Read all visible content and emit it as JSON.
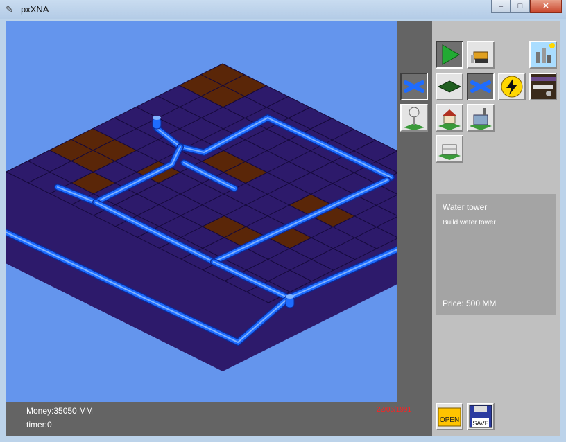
{
  "window": {
    "title": "pxXNA",
    "min": "–",
    "max": "□",
    "close": "✕"
  },
  "status": {
    "money": "Money:35050 MM",
    "timer": "timer:0",
    "date": "22/06/1991"
  },
  "info": {
    "title": "Water tower",
    "description": "Build water tower",
    "price": "Price: 500 MM"
  },
  "tools": [
    {
      "name": "play",
      "icon": "play-icon"
    },
    {
      "name": "bulldozer",
      "icon": "bulldozer-icon"
    },
    {
      "name": "city-view",
      "icon": "city-view-icon"
    },
    {
      "name": "pipe-left",
      "icon": "pipe-icon"
    },
    {
      "name": "ground",
      "icon": "ground-tile-icon"
    },
    {
      "name": "pipe",
      "icon": "pipe-icon"
    },
    {
      "name": "power",
      "icon": "lightning-icon"
    },
    {
      "name": "underground",
      "icon": "underground-icon"
    },
    {
      "name": "water-tower",
      "icon": "water-tower-icon"
    },
    {
      "name": "house",
      "icon": "house-icon"
    },
    {
      "name": "factory",
      "icon": "factory-icon"
    },
    {
      "name": "office",
      "icon": "office-icon"
    },
    {
      "name": "open",
      "icon": "folder-open-icon",
      "label": "OPEN"
    },
    {
      "name": "save",
      "icon": "floppy-save-icon",
      "label": "SAVE"
    }
  ],
  "colors": {
    "sky": "#6495ed",
    "tile": "#2d1a6b",
    "grid": "#15093a",
    "dirt": "#5a2608",
    "pipe": "#1e6cff",
    "pipe_light": "#7fb2ff"
  }
}
